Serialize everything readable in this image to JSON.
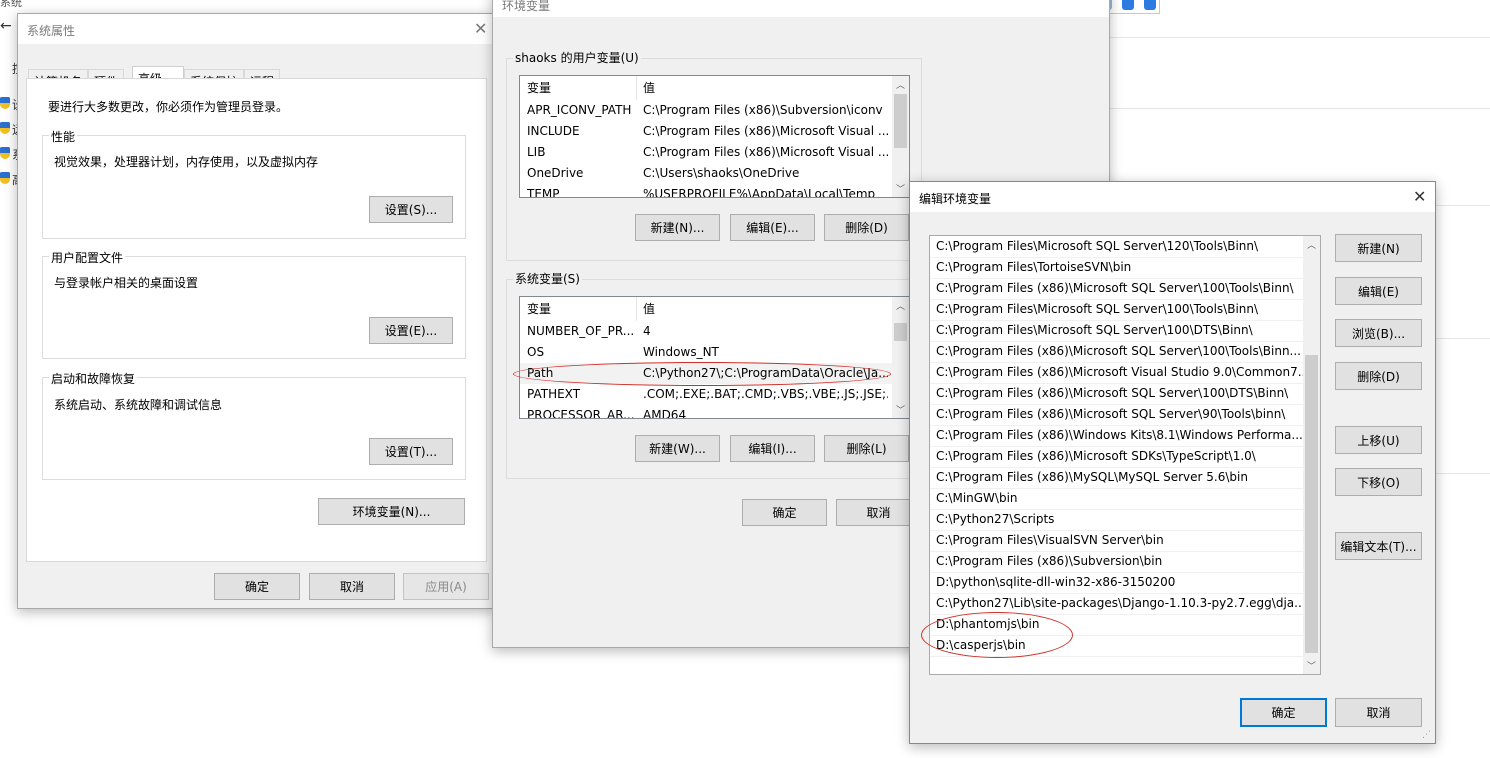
{
  "background": {
    "title": "系统",
    "back_arrow": "←",
    "left_letters": [
      "控",
      "设",
      "远",
      "系",
      "高"
    ]
  },
  "sysprop": {
    "title": "系统属性",
    "tabs": [
      "计算机名",
      "硬件",
      "高级",
      "系统保护",
      "远程"
    ],
    "admin_note": "要进行大多数更改，你必须作为管理员登录。",
    "performance": {
      "label": "性能",
      "desc": "视觉效果，处理器计划，内存使用，以及虚拟内存",
      "button": "设置(S)..."
    },
    "profile": {
      "label": "用户配置文件",
      "desc": "与登录帐户相关的桌面设置",
      "button": "设置(E)..."
    },
    "startup": {
      "label": "启动和故障恢复",
      "desc": "系统启动、系统故障和调试信息",
      "button": "设置(T)..."
    },
    "env_button": "环境变量(N)...",
    "ok": "确定",
    "cancel": "取消",
    "apply": "应用(A)"
  },
  "envvars": {
    "title": "环境变量",
    "user_group": "shaoks 的用户变量(U)",
    "col_var": "变量",
    "col_val": "值",
    "user_rows": [
      {
        "name": "APR_ICONV_PATH",
        "value": "C:\\Program Files (x86)\\Subversion\\iconv"
      },
      {
        "name": "INCLUDE",
        "value": "C:\\Program Files (x86)\\Microsoft Visual ..."
      },
      {
        "name": "LIB",
        "value": "C:\\Program Files (x86)\\Microsoft Visual ..."
      },
      {
        "name": "OneDrive",
        "value": "C:\\Users\\shaoks\\OneDrive"
      },
      {
        "name": "TEMP",
        "value": "%USERPROFILE%\\AppData\\Local\\Temp"
      }
    ],
    "user_buttons": {
      "new": "新建(N)...",
      "edit": "编辑(E)...",
      "delete": "删除(D)"
    },
    "system_group": "系统变量(S)",
    "system_rows": [
      {
        "name": "NUMBER_OF_PR...",
        "value": "4"
      },
      {
        "name": "OS",
        "value": "Windows_NT"
      },
      {
        "name": "Path",
        "value": "C:\\Python27\\;C:\\ProgramData\\Oracle\\Ja..."
      },
      {
        "name": "PATHEXT",
        "value": ".COM;.EXE;.BAT;.CMD;.VBS;.VBE;.JS;.JSE;..."
      },
      {
        "name": "PROCESSOR_AR...",
        "value": "AMD64"
      }
    ],
    "system_buttons": {
      "new": "新建(W)...",
      "edit": "编辑(I)...",
      "delete": "删除(L)"
    },
    "ok": "确定",
    "cancel": "取消"
  },
  "editenv": {
    "title": "编辑环境变量",
    "close": "✕",
    "paths": [
      "C:\\Program Files\\Microsoft SQL Server\\120\\Tools\\Binn\\",
      "C:\\Program Files\\TortoiseSVN\\bin",
      "C:\\Program Files (x86)\\Microsoft SQL Server\\100\\Tools\\Binn\\",
      "C:\\Program Files\\Microsoft SQL Server\\100\\Tools\\Binn\\",
      "C:\\Program Files\\Microsoft SQL Server\\100\\DTS\\Binn\\",
      "C:\\Program Files (x86)\\Microsoft SQL Server\\100\\Tools\\Binn...",
      "C:\\Program Files (x86)\\Microsoft Visual Studio 9.0\\Common7...",
      "C:\\Program Files (x86)\\Microsoft SQL Server\\100\\DTS\\Binn\\",
      "C:\\Program Files (x86)\\Microsoft SQL Server\\90\\Tools\\binn\\",
      "C:\\Program Files (x86)\\Windows Kits\\8.1\\Windows Performa...",
      "C:\\Program Files (x86)\\Microsoft SDKs\\TypeScript\\1.0\\",
      "C:\\Program Files (x86)\\MySQL\\MySQL Server 5.6\\bin",
      "C:\\MinGW\\bin",
      "C:\\Python27\\Scripts",
      "C:\\Program Files\\VisualSVN Server\\bin",
      "C:\\Program Files (x86)\\Subversion\\bin",
      "D:\\python\\sqlite-dll-win32-x86-3150200",
      "C:\\Python27\\Lib\\site-packages\\Django-1.10.3-py2.7.egg\\dja...",
      "D:\\phantomjs\\bin",
      "D:\\casperjs\\bin"
    ],
    "buttons": {
      "new": "新建(N)",
      "edit": "编辑(E)",
      "browse": "浏览(B)...",
      "delete": "删除(D)",
      "up": "上移(U)",
      "down": "下移(O)",
      "edit_text": "编辑文本(T)..."
    },
    "ok": "确定",
    "cancel": "取消"
  },
  "colors": {
    "accent": "#0078d7",
    "annotation": "#d0302a"
  }
}
